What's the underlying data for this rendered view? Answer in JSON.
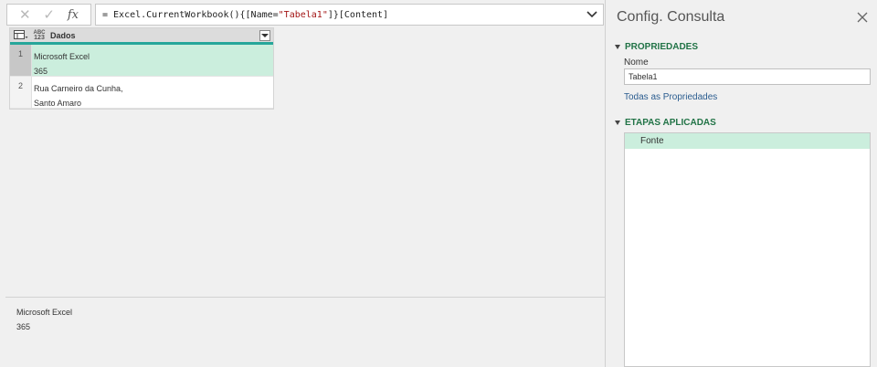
{
  "formula_bar": {
    "cancel_icon": "close-icon",
    "confirm_icon": "check-icon",
    "fx_label": "fx",
    "formula_prefix": "= Excel.CurrentWorkbook(){[Name=",
    "formula_string": "\"Tabela1\"",
    "formula_suffix": "]}[Content]"
  },
  "table": {
    "column": {
      "type_label_top": "ABC",
      "type_label_bottom": "123",
      "name": "Dados"
    },
    "rows": [
      {
        "num": "1",
        "line1": "Microsoft Excel",
        "line2": "365",
        "selected": true
      },
      {
        "num": "2",
        "line1": "Rua Carneiro da Cunha,",
        "line2": "Santo Amaro",
        "selected": false
      }
    ]
  },
  "preview": {
    "line1": "Microsoft Excel",
    "line2": "365"
  },
  "side": {
    "title": "Config. Consulta",
    "properties_header": "PROPRIEDADES",
    "name_label": "Nome",
    "name_value": "Tabela1",
    "all_properties_link": "Todas as Propriedades",
    "steps_header": "ETAPAS APLICADAS",
    "steps": [
      "Fonte"
    ]
  },
  "colors": {
    "accent_green": "#217346",
    "selection": "#cbeedd",
    "column_bar": "#26a69a"
  }
}
